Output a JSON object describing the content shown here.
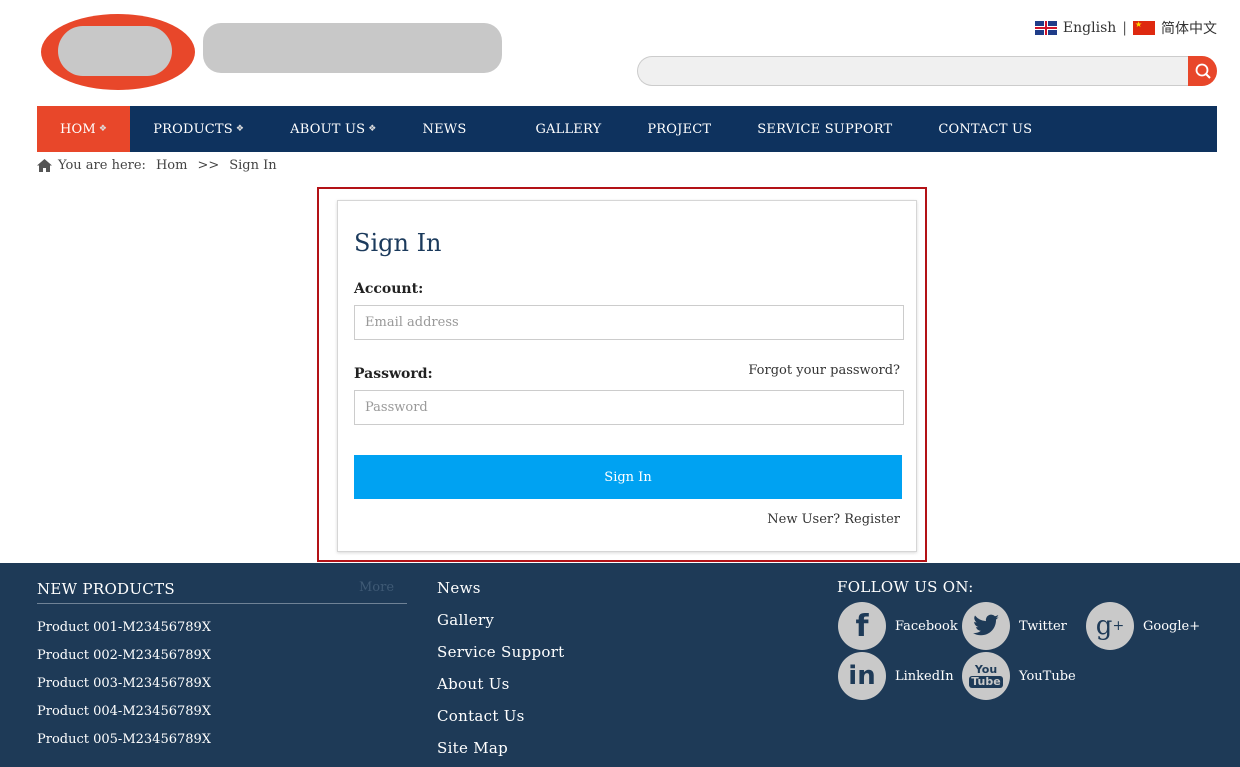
{
  "header": {
    "lang_english": "English",
    "lang_separator": "|",
    "lang_chinese": "简体中文",
    "search_placeholder": ""
  },
  "nav": {
    "items": [
      {
        "label": "HOM",
        "has_dropdown": true,
        "active": true
      },
      {
        "label": "PRODUCTS",
        "has_dropdown": true
      },
      {
        "label": "ABOUT US",
        "has_dropdown": true
      },
      {
        "label": "NEWS",
        "has_dropdown": false
      },
      {
        "label": "GALLERY",
        "has_dropdown": false
      },
      {
        "label": "PROJECT",
        "has_dropdown": false
      },
      {
        "label": "SERVICE SUPPORT",
        "has_dropdown": false
      },
      {
        "label": "CONTACT US",
        "has_dropdown": false
      }
    ]
  },
  "breadcrumb": {
    "prefix": "You are here:",
    "home": "Hom",
    "separator": ">>",
    "current": "Sign In"
  },
  "signin": {
    "title": "Sign In",
    "account_label": "Account:",
    "account_placeholder": "Email address",
    "password_label": "Password:",
    "password_placeholder": "Password",
    "forgot_link": "Forgot your password?",
    "button_label": "Sign In",
    "register_link": "New User? Register"
  },
  "footer": {
    "new_products_title": "NEW PRODUCTS",
    "more_link": "More",
    "products": [
      "Product 001-M23456789X",
      "Product 002-M23456789X",
      "Product 003-M23456789X",
      "Product 004-M23456789X",
      "Product 005-M23456789X"
    ],
    "links": [
      "News",
      "Gallery",
      "Service Support",
      "About Us",
      "Contact Us",
      "Site Map"
    ],
    "follow_title": "FOLLOW US ON:",
    "social": [
      {
        "label": "Facebook",
        "icon": "facebook-icon"
      },
      {
        "label": "Twitter",
        "icon": "twitter-icon"
      },
      {
        "label": "Google+",
        "icon": "google-plus-icon"
      },
      {
        "label": "LinkedIn",
        "icon": "linkedin-icon"
      },
      {
        "label": "YouTube",
        "icon": "youtube-icon"
      }
    ]
  },
  "colors": {
    "accent": "#e8472a",
    "nav_bg": "#0e325e",
    "footer_bg": "#1e3a57",
    "button": "#00a2f2",
    "frame": "#b31217"
  }
}
